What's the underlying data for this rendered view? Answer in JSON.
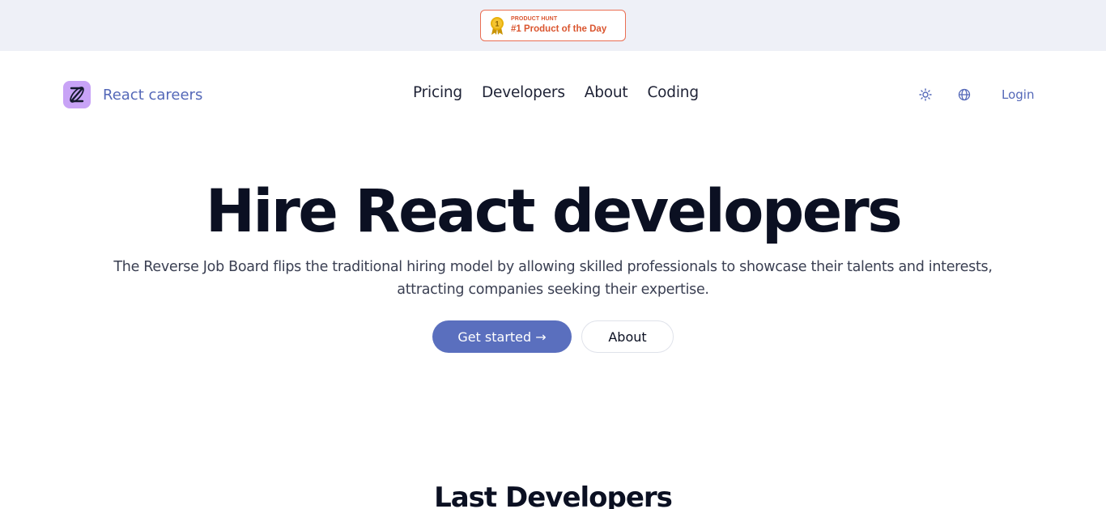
{
  "producthunt_badge": {
    "small_label": "PRODUCT HUNT",
    "main_label": "#1 Product of the Day",
    "medal_number": "1",
    "accent_color": "#da552f",
    "medal_color": "#e8b10a"
  },
  "header": {
    "brand_name": "React careers",
    "logo_color": "#c8a3f6",
    "nav_links": [
      "Pricing",
      "Developers",
      "About",
      "Coding"
    ],
    "theme_icon": "sun-icon",
    "language_icon": "globe-icon",
    "login_label": "Login"
  },
  "hero": {
    "title": "Hire React developers",
    "subtitle": "The Reverse Job Board flips the traditional hiring model by allowing skilled professionals to showcase their talents and interests, attracting companies seeking their expertise.",
    "primary_button": "Get started →",
    "secondary_button": "About",
    "primary_color": "#5a6fbe"
  },
  "developers_section": {
    "title": "Last Developers"
  }
}
